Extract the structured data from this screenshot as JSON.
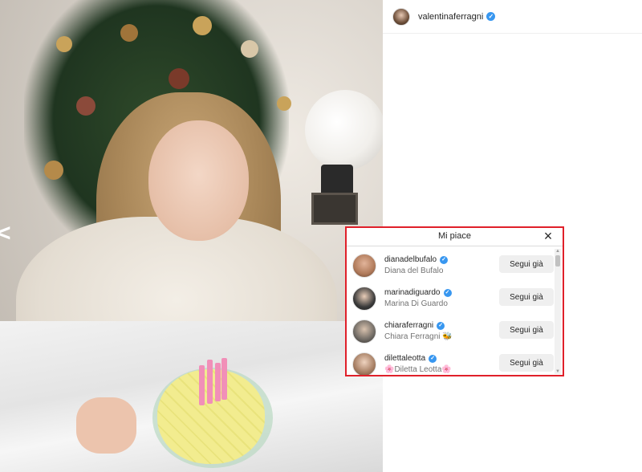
{
  "header": {
    "username": "valentinaferragni"
  },
  "photo": {
    "nav_arrow_glyph": "<"
  },
  "likes_modal": {
    "title": "Mi piace",
    "close_glyph": "×",
    "users": [
      {
        "username": "dianadelbufalo",
        "full_name": "Diana del Bufalo",
        "verified": true,
        "button": "Segui già",
        "avatar_color": "#b07a5a"
      },
      {
        "username": "marinadiguardo",
        "full_name": "Marina Di Guardo",
        "verified": true,
        "button": "Segui già",
        "avatar_color": "#3b3b3b"
      },
      {
        "username": "chiaraferragni",
        "full_name": "Chiara Ferragni 🐝",
        "verified": true,
        "button": "Segui già",
        "avatar_color": "#6f6a64"
      },
      {
        "username": "dilettaleotta",
        "full_name": "🌸Diletta Leotta🌸",
        "verified": true,
        "button": "Segui già",
        "avatar_color": "#a57d62"
      }
    ]
  },
  "colors": {
    "verified_badge": "#3897f0",
    "highlight_border": "#e0202a",
    "button_bg": "#efefef"
  },
  "icons": {
    "verified": "verified-badge-icon",
    "close": "close-icon",
    "nav_prev": "chevron-left-icon"
  }
}
